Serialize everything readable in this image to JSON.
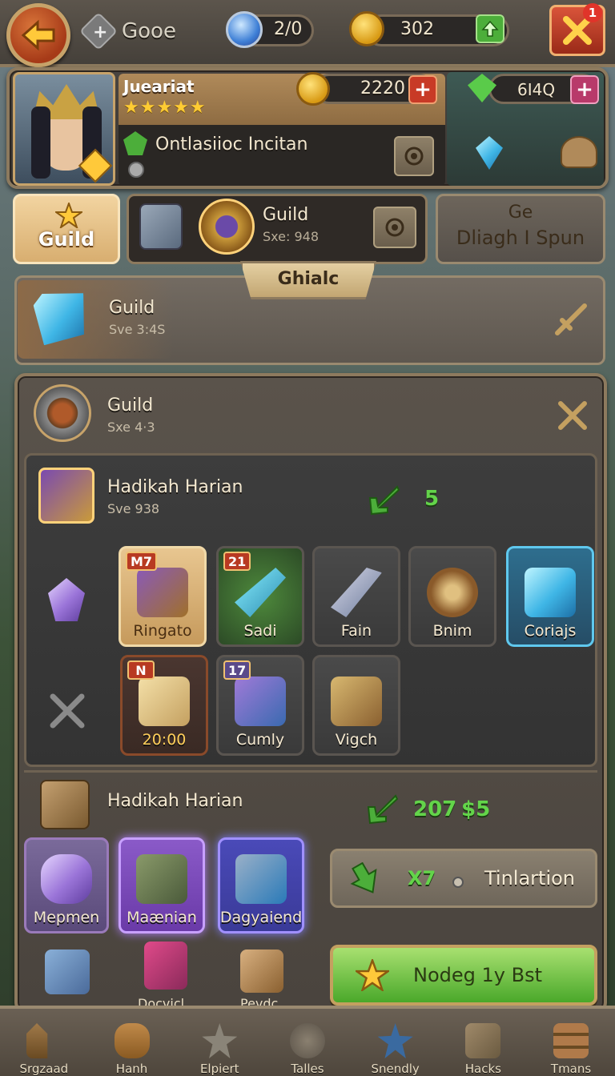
{
  "topbar": {
    "search_label": "Gooe",
    "energy_value": "2/0",
    "gold_value": "302",
    "notification_count": "1"
  },
  "profile": {
    "name": "Jueariat",
    "stars": "★★★★★",
    "currency_value": "2220",
    "gem_value": "6I4Q",
    "status_text": "Ontlasiioc Incitan"
  },
  "actions": {
    "guild_button": "Guild",
    "guild_card_title": "Guild",
    "guild_card_sub": "Sxe: 948",
    "spin_line1": "Ge",
    "spin_line2": "Dliagh I Spun"
  },
  "banner": {
    "label": "Ghialc"
  },
  "guild_row1": {
    "title": "Guild",
    "sub": "Sve 3:4S"
  },
  "guild_panel": {
    "title": "Guild",
    "sub": "Sxe 4·3",
    "section1": {
      "title": "Hadikah Harian",
      "sub": "Sve 938",
      "count": "5",
      "items": [
        {
          "label": "Ringato",
          "badge": "M7"
        },
        {
          "label": "Sadi",
          "badge": "21"
        },
        {
          "label": "Fain",
          "badge": ""
        },
        {
          "label": "Bnim",
          "badge": ""
        },
        {
          "label": "Coriajs",
          "badge": ""
        },
        {
          "label": "20:00",
          "badge": "N"
        },
        {
          "label": "Cumly",
          "badge": "17"
        },
        {
          "label": "Vigch",
          "badge": ""
        }
      ]
    },
    "section2": {
      "title": "Hadikah Harian",
      "value1": "207",
      "value2": "$5",
      "items": [
        {
          "label": "Mepmen"
        },
        {
          "label": "Maænian"
        },
        {
          "label": "Dagyaiend"
        }
      ],
      "extra_items": [
        {
          "label": ""
        },
        {
          "label": "Docvicl"
        },
        {
          "label": "Pevdc"
        }
      ],
      "claim_mult": "X7",
      "claim_label": "Tinlartion",
      "go_button": "Nodeg 1y Bst"
    }
  },
  "nav": [
    {
      "label": "Srgzaad"
    },
    {
      "label": "Hanh"
    },
    {
      "label": "Elpiert"
    },
    {
      "label": "Talles"
    },
    {
      "label": "Snendly"
    },
    {
      "label": "Hacks"
    },
    {
      "label": "Tmans"
    }
  ]
}
